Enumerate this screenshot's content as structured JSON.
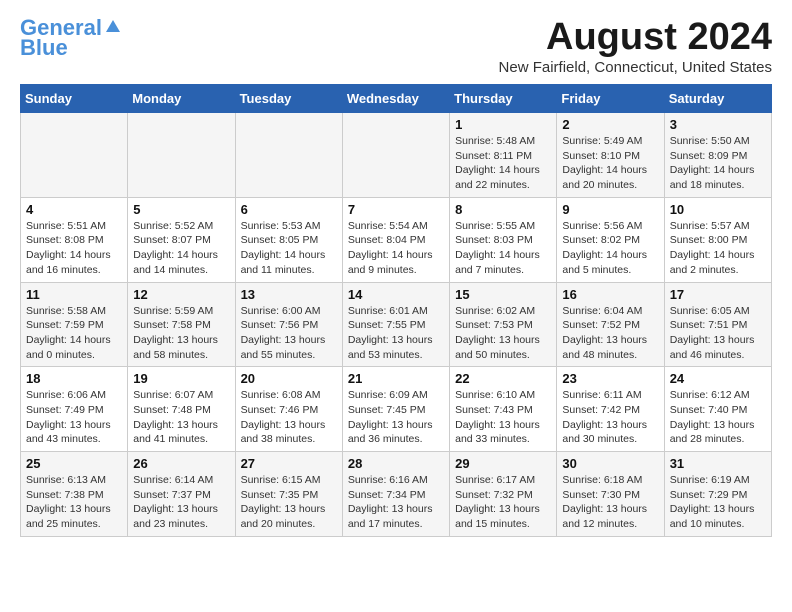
{
  "logo": {
    "line1": "General",
    "line2": "Blue"
  },
  "title": "August 2024",
  "subtitle": "New Fairfield, Connecticut, United States",
  "days_of_week": [
    "Sunday",
    "Monday",
    "Tuesday",
    "Wednesday",
    "Thursday",
    "Friday",
    "Saturday"
  ],
  "weeks": [
    [
      {
        "day": "",
        "info": ""
      },
      {
        "day": "",
        "info": ""
      },
      {
        "day": "",
        "info": ""
      },
      {
        "day": "",
        "info": ""
      },
      {
        "day": "1",
        "info": "Sunrise: 5:48 AM\nSunset: 8:11 PM\nDaylight: 14 hours\nand 22 minutes."
      },
      {
        "day": "2",
        "info": "Sunrise: 5:49 AM\nSunset: 8:10 PM\nDaylight: 14 hours\nand 20 minutes."
      },
      {
        "day": "3",
        "info": "Sunrise: 5:50 AM\nSunset: 8:09 PM\nDaylight: 14 hours\nand 18 minutes."
      }
    ],
    [
      {
        "day": "4",
        "info": "Sunrise: 5:51 AM\nSunset: 8:08 PM\nDaylight: 14 hours\nand 16 minutes."
      },
      {
        "day": "5",
        "info": "Sunrise: 5:52 AM\nSunset: 8:07 PM\nDaylight: 14 hours\nand 14 minutes."
      },
      {
        "day": "6",
        "info": "Sunrise: 5:53 AM\nSunset: 8:05 PM\nDaylight: 14 hours\nand 11 minutes."
      },
      {
        "day": "7",
        "info": "Sunrise: 5:54 AM\nSunset: 8:04 PM\nDaylight: 14 hours\nand 9 minutes."
      },
      {
        "day": "8",
        "info": "Sunrise: 5:55 AM\nSunset: 8:03 PM\nDaylight: 14 hours\nand 7 minutes."
      },
      {
        "day": "9",
        "info": "Sunrise: 5:56 AM\nSunset: 8:02 PM\nDaylight: 14 hours\nand 5 minutes."
      },
      {
        "day": "10",
        "info": "Sunrise: 5:57 AM\nSunset: 8:00 PM\nDaylight: 14 hours\nand 2 minutes."
      }
    ],
    [
      {
        "day": "11",
        "info": "Sunrise: 5:58 AM\nSunset: 7:59 PM\nDaylight: 14 hours\nand 0 minutes."
      },
      {
        "day": "12",
        "info": "Sunrise: 5:59 AM\nSunset: 7:58 PM\nDaylight: 13 hours\nand 58 minutes."
      },
      {
        "day": "13",
        "info": "Sunrise: 6:00 AM\nSunset: 7:56 PM\nDaylight: 13 hours\nand 55 minutes."
      },
      {
        "day": "14",
        "info": "Sunrise: 6:01 AM\nSunset: 7:55 PM\nDaylight: 13 hours\nand 53 minutes."
      },
      {
        "day": "15",
        "info": "Sunrise: 6:02 AM\nSunset: 7:53 PM\nDaylight: 13 hours\nand 50 minutes."
      },
      {
        "day": "16",
        "info": "Sunrise: 6:04 AM\nSunset: 7:52 PM\nDaylight: 13 hours\nand 48 minutes."
      },
      {
        "day": "17",
        "info": "Sunrise: 6:05 AM\nSunset: 7:51 PM\nDaylight: 13 hours\nand 46 minutes."
      }
    ],
    [
      {
        "day": "18",
        "info": "Sunrise: 6:06 AM\nSunset: 7:49 PM\nDaylight: 13 hours\nand 43 minutes."
      },
      {
        "day": "19",
        "info": "Sunrise: 6:07 AM\nSunset: 7:48 PM\nDaylight: 13 hours\nand 41 minutes."
      },
      {
        "day": "20",
        "info": "Sunrise: 6:08 AM\nSunset: 7:46 PM\nDaylight: 13 hours\nand 38 minutes."
      },
      {
        "day": "21",
        "info": "Sunrise: 6:09 AM\nSunset: 7:45 PM\nDaylight: 13 hours\nand 36 minutes."
      },
      {
        "day": "22",
        "info": "Sunrise: 6:10 AM\nSunset: 7:43 PM\nDaylight: 13 hours\nand 33 minutes."
      },
      {
        "day": "23",
        "info": "Sunrise: 6:11 AM\nSunset: 7:42 PM\nDaylight: 13 hours\nand 30 minutes."
      },
      {
        "day": "24",
        "info": "Sunrise: 6:12 AM\nSunset: 7:40 PM\nDaylight: 13 hours\nand 28 minutes."
      }
    ],
    [
      {
        "day": "25",
        "info": "Sunrise: 6:13 AM\nSunset: 7:38 PM\nDaylight: 13 hours\nand 25 minutes."
      },
      {
        "day": "26",
        "info": "Sunrise: 6:14 AM\nSunset: 7:37 PM\nDaylight: 13 hours\nand 23 minutes."
      },
      {
        "day": "27",
        "info": "Sunrise: 6:15 AM\nSunset: 7:35 PM\nDaylight: 13 hours\nand 20 minutes."
      },
      {
        "day": "28",
        "info": "Sunrise: 6:16 AM\nSunset: 7:34 PM\nDaylight: 13 hours\nand 17 minutes."
      },
      {
        "day": "29",
        "info": "Sunrise: 6:17 AM\nSunset: 7:32 PM\nDaylight: 13 hours\nand 15 minutes."
      },
      {
        "day": "30",
        "info": "Sunrise: 6:18 AM\nSunset: 7:30 PM\nDaylight: 13 hours\nand 12 minutes."
      },
      {
        "day": "31",
        "info": "Sunrise: 6:19 AM\nSunset: 7:29 PM\nDaylight: 13 hours\nand 10 minutes."
      }
    ]
  ]
}
